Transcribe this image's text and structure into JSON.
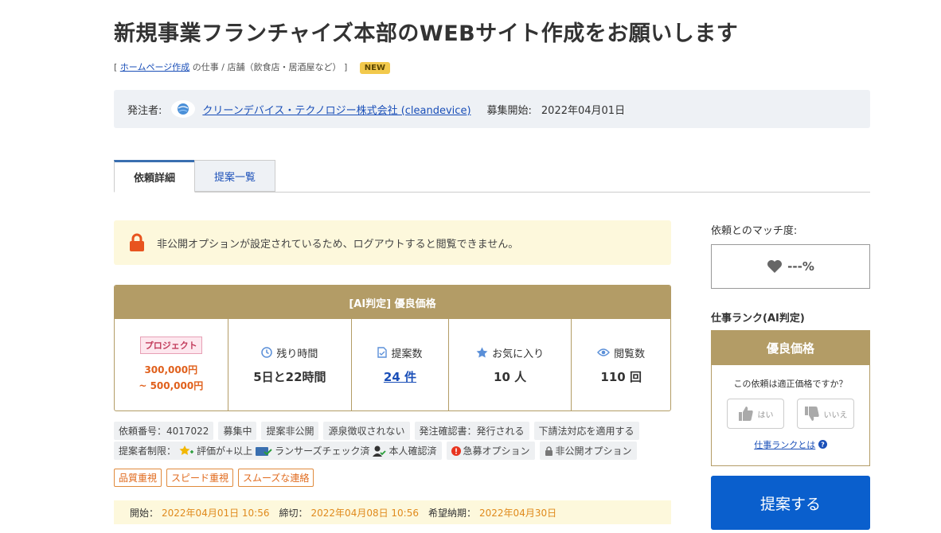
{
  "title": "新規事業フランチャイズ本部のWEBサイト作成をお願いします",
  "breadcrumb": {
    "open": "[",
    "category_link": "ホームページ作成",
    "category_suffix": "の仕事",
    "sep": "/",
    "subcategory": "店舗（飲食店・居酒屋など）",
    "close": "]",
    "new_badge": "NEW"
  },
  "client": {
    "label": "発注者:",
    "name": "クリーンデバイス・テクノロジー株式会社 (cleandevice)",
    "start_label": "募集開始:",
    "start_date": "2022年04月01日"
  },
  "tabs": [
    "依頼詳細",
    "提案一覧"
  ],
  "notice": "非公開オプションが設定されているため、ログアウトすると閲覧できません。",
  "panel": {
    "header": "[AI判定] 優良価格",
    "type_badge": "プロジェクト",
    "price_min": "300,000円",
    "price_max": "~ 500,000円",
    "remaining_label": "残り時間",
    "remaining_value": "5日と22時間",
    "proposals_label": "提案数",
    "proposals_value": "24 件",
    "favorites_label": "お気に入り",
    "favorites_value": "10 人",
    "views_label": "閲覧数",
    "views_value": "110 回"
  },
  "tags_row1": [
    "依頼番号：4017022",
    "募集中",
    "提案非公開",
    "源泉徴収されない",
    "発注確認書：発行される",
    "下請法対応を適用する"
  ],
  "tags_row2": {
    "limit_label": "提案者制限：",
    "rating": "評価が+以上",
    "lancers_check": "ランサーズチェック済",
    "identity": "本人確認済",
    "urgent": "急募オプション",
    "private": "非公開オプション"
  },
  "orange_tags": [
    "品質重視",
    "スピード重視",
    "スムーズな連絡"
  ],
  "dates": {
    "start_label": "開始：",
    "start": "2022年04月01日 10:56",
    "end_label": "締切：",
    "end": "2022年04月08日 10:56",
    "deadline_label": "希望納期：",
    "deadline": "2022年04月30日"
  },
  "sidebar": {
    "match_label": "依頼とのマッチ度:",
    "match_value": "---%",
    "rank_label": "仕事ランク(AI判定)",
    "rank_value": "優良価格",
    "rank_question": "この依頼は適正価格ですか？",
    "yes": "はい",
    "no": "いいえ",
    "about_link": "仕事ランクとは",
    "propose_button": "提案する"
  },
  "colors": {
    "gold": "#b39c66",
    "blue": "#0a5fcd",
    "orange": "#e0601c",
    "notice_bg": "#fdf8dc"
  }
}
